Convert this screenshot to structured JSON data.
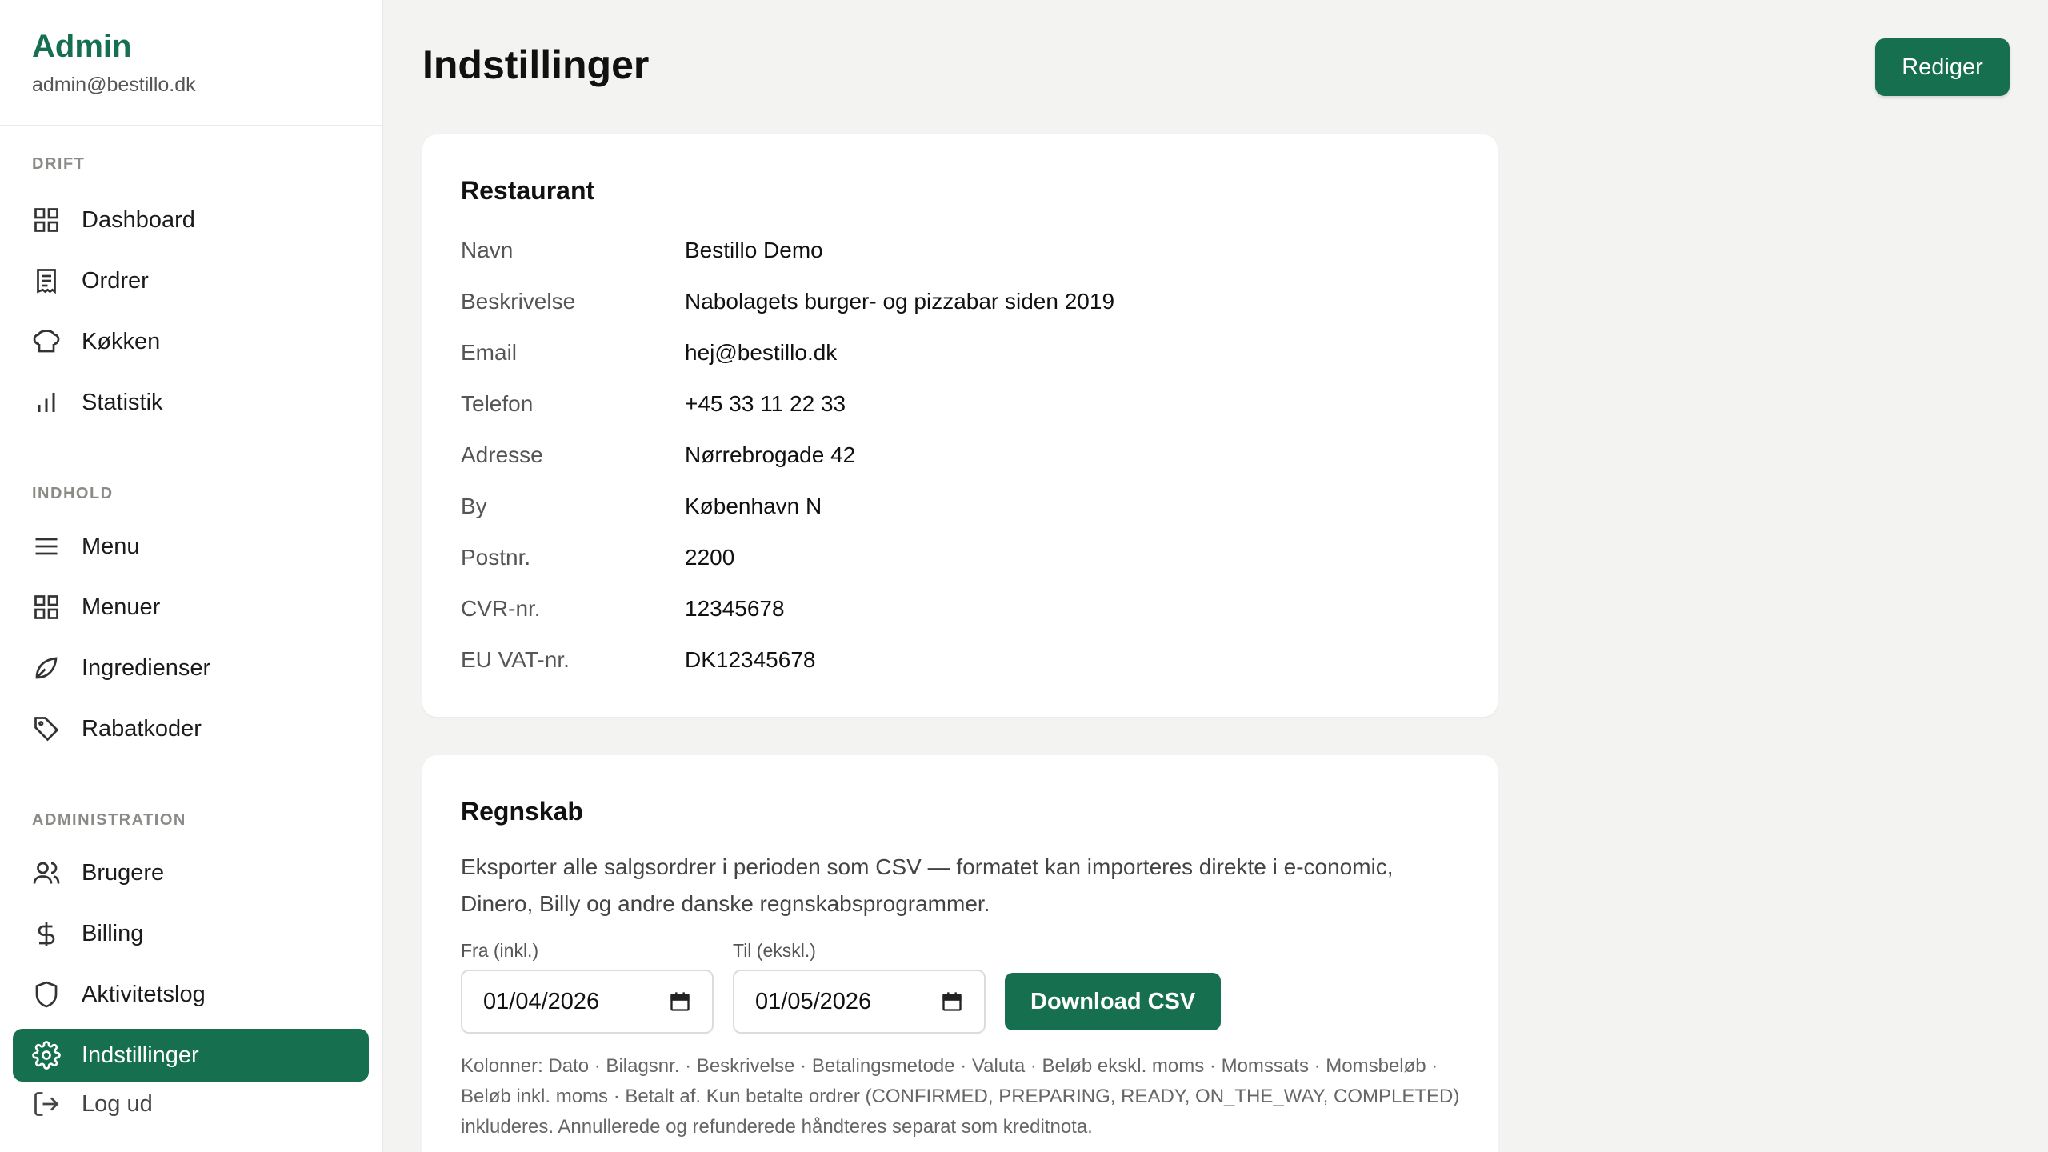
{
  "sidebar": {
    "brand_title": "Admin",
    "brand_email": "admin@bestillo.dk",
    "sections": [
      {
        "label": "DRIFT",
        "items": [
          {
            "label": "Dashboard",
            "icon": "grid-icon"
          },
          {
            "label": "Ordrer",
            "icon": "receipt-icon"
          },
          {
            "label": "Køkken",
            "icon": "chef-hat-icon"
          },
          {
            "label": "Statistik",
            "icon": "bar-chart-icon"
          }
        ]
      },
      {
        "label": "INDHOLD",
        "items": [
          {
            "label": "Menu",
            "icon": "menu-lines-icon"
          },
          {
            "label": "Menuer",
            "icon": "grid-icon"
          },
          {
            "label": "Ingredienser",
            "icon": "leaf-icon"
          },
          {
            "label": "Rabatkoder",
            "icon": "tag-icon"
          }
        ]
      },
      {
        "label": "ADMINISTRATION",
        "items": [
          {
            "label": "Brugere",
            "icon": "users-icon"
          },
          {
            "label": "Billing",
            "icon": "dollar-icon"
          },
          {
            "label": "Aktivitetslog",
            "icon": "shield-icon"
          },
          {
            "label": "Indstillinger",
            "icon": "gear-icon",
            "active": true
          }
        ]
      }
    ],
    "logout_label": "Log ud"
  },
  "header": {
    "title": "Indstillinger",
    "edit_label": "Rediger"
  },
  "restaurant": {
    "title": "Restaurant",
    "rows": [
      {
        "label": "Navn",
        "value": "Bestillo Demo"
      },
      {
        "label": "Beskrivelse",
        "value": "Nabolagets burger- og pizzabar siden 2019"
      },
      {
        "label": "Email",
        "value": "hej@bestillo.dk"
      },
      {
        "label": "Telefon",
        "value": "+45 33 11 22 33"
      },
      {
        "label": "Adresse",
        "value": "Nørrebrogade 42"
      },
      {
        "label": "By",
        "value": "København N"
      },
      {
        "label": "Postnr.",
        "value": "2200"
      },
      {
        "label": "CVR-nr.",
        "value": "12345678"
      },
      {
        "label": "EU VAT-nr.",
        "value": "DK12345678"
      }
    ]
  },
  "accounting": {
    "title": "Regnskab",
    "description": "Eksporter alle salgsordrer i perioden som CSV — formatet kan importeres direkte i e-conomic, Dinero, Billy og andre danske regnskabsprogrammer.",
    "from_label": "Fra (inkl.)",
    "from_value": "01/04/2026",
    "to_label": "Til (ekskl.)",
    "to_value": "01/05/2026",
    "download_label": "Download CSV",
    "columns_note": "Kolonner: Dato · Bilagsnr. · Beskrivelse · Betalingsmetode · Valuta · Beløb ekskl. moms · Momssats · Momsbeløb · Beløb inkl. moms · Betalt af. Kun betalte ordrer (CONFIRMED, PREPARING, READY, ON_THE_WAY, COMPLETED) inkluderes. Annullerede og refunderede håndteres separat som kreditnota."
  },
  "colors": {
    "accent": "#16704f",
    "background": "#f3f3f1"
  }
}
